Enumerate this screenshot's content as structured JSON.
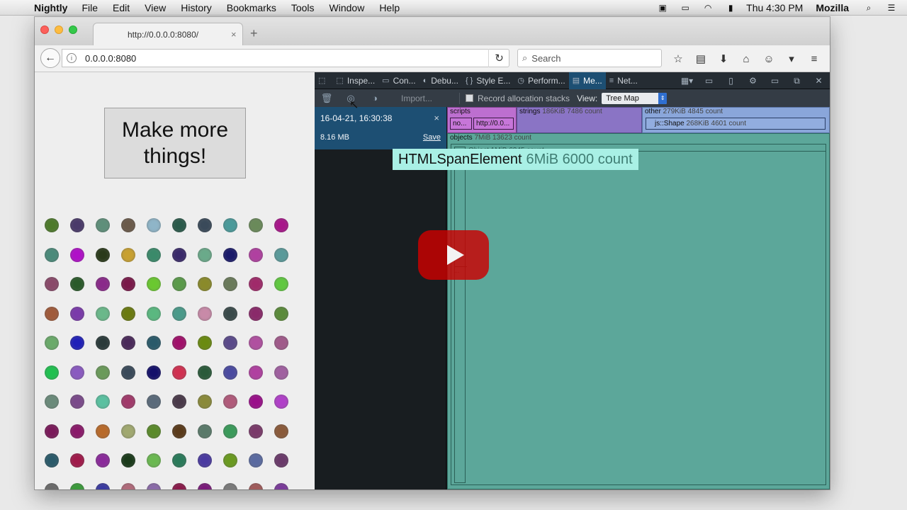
{
  "menubar": {
    "app_name": "Nightly",
    "items": [
      "File",
      "Edit",
      "View",
      "History",
      "Bookmarks",
      "Tools",
      "Window",
      "Help"
    ],
    "clock": "Thu 4:30 PM",
    "user": "Mozilla"
  },
  "browser": {
    "tab_title": "http://0.0.0.0:8080/",
    "tab_close": "×",
    "new_tab": "+",
    "url": "0.0.0.0:8080",
    "search_placeholder": "Search"
  },
  "page": {
    "button_label": "Make more things!",
    "dot_colors": [
      [
        "#4d7a2b",
        "#4a3a6a",
        "#5e8f7a",
        "#6a5a4a",
        "#8fb5c8",
        "#2a5a4a",
        "#3a4a5a",
        "#4a9a9a",
        "#6a8a5a",
        "#a8168a"
      ],
      [
        "#4a8a7a",
        "#b010c8",
        "#2a3a1a",
        "#c8a030",
        "#3a8a6a",
        "#3a2a6a",
        "#6aaa8a",
        "#1a1a6a",
        "#b040a0",
        "#5a9a9a"
      ],
      [
        "#8a4a6a",
        "#2a5a2a",
        "#8a2a8a",
        "#7a1a4a",
        "#6ac830",
        "#5a9a4a",
        "#8a8a2a",
        "#6a7a5a",
        "#a02a6a",
        "#60c840"
      ],
      [
        "#a05a3a",
        "#7a3aaa",
        "#6ab88a",
        "#6a7a10",
        "#5ab880",
        "#4a9a8a",
        "#c88aa8",
        "#3a4a4a",
        "#8a2a6a",
        "#5a8a3a"
      ],
      [
        "#6aaa6a",
        "#2020b8",
        "#2a3a3a",
        "#4a2a5a",
        "#2a5a6a",
        "#a0106a",
        "#6a8a10",
        "#5a4a8a",
        "#b050a0",
        "#a05a8a"
      ],
      [
        "#20c050",
        "#8a5ac0",
        "#6a9a5a",
        "#3a4a5a",
        "#14106a",
        "#d03050",
        "#2a5a3a",
        "#4a4aa0",
        "#b040a0",
        "#a060a0"
      ],
      [
        "#6a8a7a",
        "#7a4a8a",
        "#5ac0a0",
        "#a03a6a",
        "#5a6a7a",
        "#4a3a4a",
        "#8a8a3a",
        "#b05a7a",
        "#9a108a",
        "#b040c8"
      ],
      [
        "#7a1a5a",
        "#8a1a6a",
        "#b86a2a",
        "#a0a870",
        "#5a8a2a",
        "#5a3a1a",
        "#5a7a6a",
        "#3a9a5a",
        "#7a3a6a",
        "#8a5a3a"
      ],
      [
        "#2a5a6a",
        "#a01a4a",
        "#8a2a9a",
        "#1a3a1a",
        "#6ab850",
        "#2a7a5a",
        "#4a3aa0",
        "#6a9a20",
        "#5a6aa0",
        "#6a3a6a"
      ],
      [
        "#6a6a6a",
        "#3a9a3a",
        "#3a3aa0",
        "#b06a7a",
        "#8a6aa8",
        "#8a1a4a",
        "#7a1a7a",
        "#7a7a7a",
        "#a05a5a",
        "#7a3a9a"
      ]
    ]
  },
  "devtools": {
    "tools": [
      {
        "icon": "⬚",
        "label": "Inspe..."
      },
      {
        "icon": "▭",
        "label": "Con..."
      },
      {
        "icon": "◐",
        "label": "Debu..."
      },
      {
        "icon": "{ }",
        "label": "Style E..."
      },
      {
        "icon": "◷",
        "label": "Perform..."
      },
      {
        "icon": "▤",
        "label": "Me..."
      },
      {
        "icon": "≡",
        "label": "Net..."
      }
    ],
    "import_label": "Import...",
    "record_label": "Record allocation stacks",
    "view_label": "View:",
    "view_value": "Tree Map",
    "snapshot": {
      "time": "16-04-21, 16:30:38",
      "close": "×",
      "size": "8.16 MB",
      "save": "Save"
    },
    "treemap": {
      "scripts": {
        "name": "scripts",
        "meta": ""
      },
      "strings": {
        "name": "strings",
        "meta": "186KiB 7486 count"
      },
      "other": {
        "name": "other",
        "meta": "279KiB 4845 count"
      },
      "objects": {
        "name": "objects",
        "meta": "7MiB 13623 count"
      },
      "scripts_no": "no...",
      "scripts_http": "http://0.0...",
      "js_shape": {
        "name": "js::Shape",
        "meta": "268KiB 4601 count"
      },
      "object_label": "Object 1MiB 6345 count",
      "small_label": "..."
    },
    "tooltip": {
      "name": "HTMLSpanElement",
      "meta": "6MiB 6000 count"
    }
  },
  "colors": {
    "devtools_selected": "#1d4f73",
    "objects_cell": "#5ca79a",
    "tooltip_bg": "#a9f0e5"
  }
}
